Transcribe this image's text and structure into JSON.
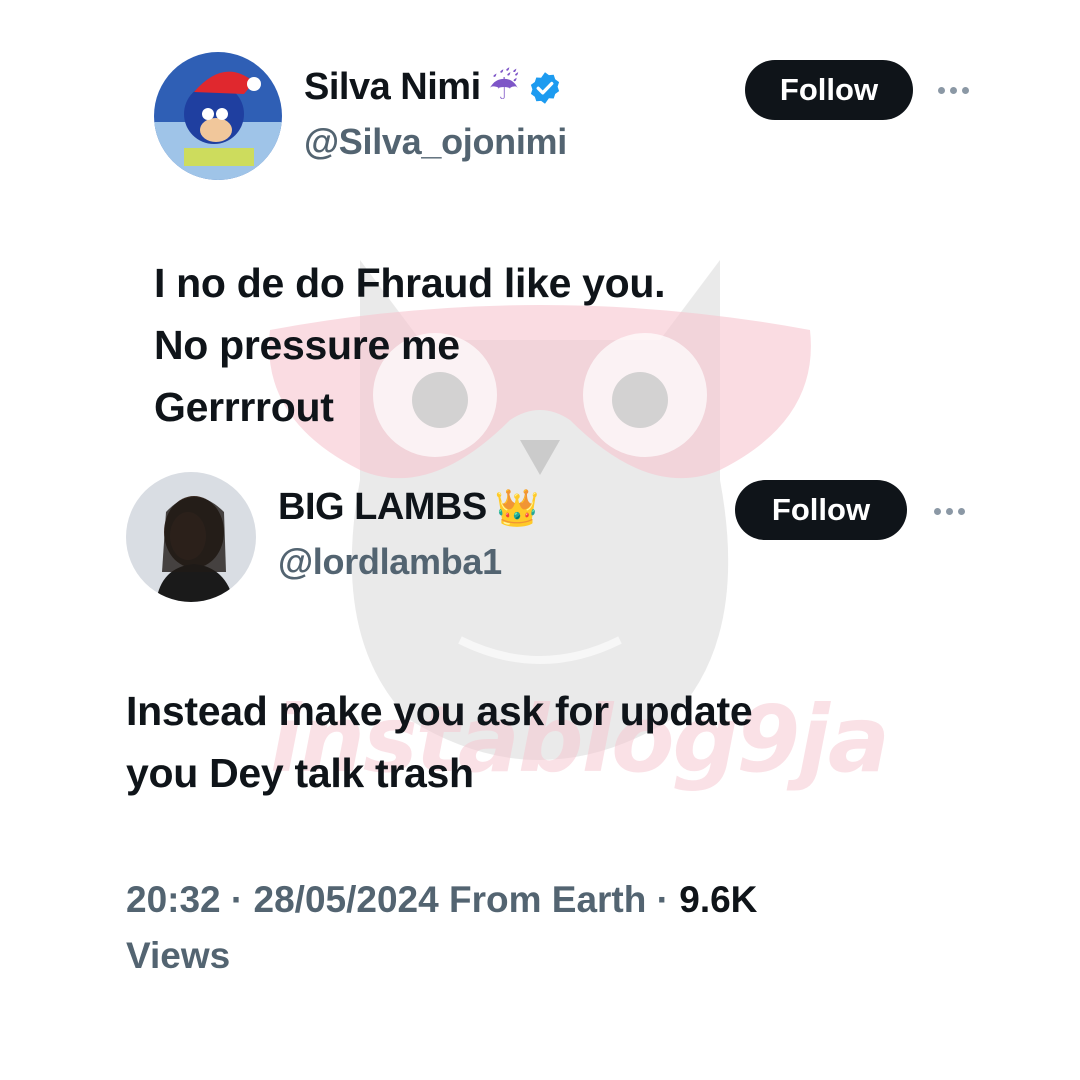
{
  "tweets": [
    {
      "name": "Silva Nimi",
      "name_emoji": "☔",
      "verified": true,
      "handle": "@Silva_ojonimi",
      "follow_label": "Follow",
      "text_lines": [
        "I no de do Fhraud like you.",
        "No pressure me",
        "Gerrrrout"
      ]
    },
    {
      "name": "BIG LAMBS",
      "name_emoji": "👑",
      "verified": false,
      "handle": "@lordlamba1",
      "follow_label": "Follow",
      "text_lines": [
        "Instead make you ask for update",
        "you Dey talk trash"
      ]
    }
  ],
  "meta": {
    "time": "20:32",
    "separator": " · ",
    "date": "28/05/2024",
    "location": "From Earth",
    "views_count": "9.6K",
    "views_label": "Views"
  },
  "watermark": {
    "text": "instablog9ja"
  },
  "colors": {
    "text_primary": "#0f1419",
    "text_secondary": "#536471",
    "verified_blue": "#1d9bf0",
    "button_bg": "#0f1419",
    "watermark_pink": "#f6c9d2",
    "watermark_gray": "#d3d3d3"
  },
  "icons": {
    "verified": "verified-badge-icon",
    "more": "more-options-icon"
  }
}
